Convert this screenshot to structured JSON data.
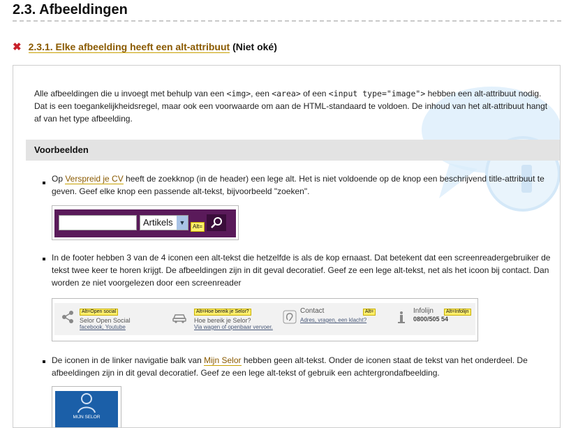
{
  "page": {
    "title": "2.3. Afbeeldingen"
  },
  "section": {
    "status": "fail",
    "link_text": "2.3.1. Elke afbeelding heeft een alt-attribuut",
    "status_text": "(Niet oké)"
  },
  "intro": {
    "t1": "Alle afbeeldingen die u invoegt met behulp van een ",
    "c1": "<img>",
    "t2": ", een ",
    "c2": "<area>",
    "t3": " of een ",
    "c3": "<input type=\"image\">",
    "t4": " hebben een alt-attribuut nodig. Dat is een toegankelijkheidsregel, maar ook een voorwaarde om aan de HTML-standaard te voldoen. De inhoud van het alt-attribuut hangt af van het type afbeelding."
  },
  "examples": {
    "heading": "Voorbeelden",
    "items": [
      {
        "pre": "Op ",
        "link": "Verspreid je CV",
        "post": " heeft de zoekknop (in de header) een lege alt. Het is niet voldoende op de knop een beschrijvend title-attribuut te geven. Geef elke knop een passende alt-tekst, bijvoorbeeld \"zoeken\"."
      },
      {
        "pre": "",
        "link": "",
        "post": "In de footer hebben 3 van de 4 iconen een alt-tekst die hetzelfde is als de kop ernaast. Dat betekent dat een screenreadergebruiker de tekst twee keer te horen krijgt. De afbeeldingen zijn in dit geval decoratief. Geef ze een lege alt-tekst, net als het icoon bij contact. Dan worden ze niet voorgelezen door een screenreader"
      },
      {
        "pre": "De iconen in de linker navigatie balk van ",
        "link": "Mijn Selor",
        "post": " hebben geen alt-tekst. Onder de iconen staat de tekst van het onderdeel. De afbeeldingen zijn in dit geval decoratief. Geef ze een lege alt-tekst of gebruik een achtergrondafbeelding."
      }
    ]
  },
  "search_example": {
    "select_value": "Artikels",
    "alt_label": "Alt="
  },
  "footer_example": {
    "tiles": [
      {
        "icon": "share-icon",
        "alt": "Alt=Open social",
        "line1": "Selor Open Social",
        "line2": "facebook, Youtube"
      },
      {
        "icon": "car-icon",
        "alt": "Alt=Hoe bereik je Selor?",
        "line1": "Hoe bereik je Selor?",
        "line2": "Via wagen of openbaar vervoer."
      },
      {
        "icon": "ear-icon",
        "alt": "Alt=",
        "line1": "Contact",
        "line2": "Adres, vragen, een klacht?"
      },
      {
        "icon": "info-icon",
        "alt": "Alt=Infolijn",
        "line1": "Infolijn",
        "line2": "0800/505 54"
      }
    ]
  },
  "selor_example": {
    "label": "MIJN SELOR"
  },
  "colors": {
    "fail": "#c8202a",
    "link": "#8a5a00",
    "examples_bar": "#e3e3e3",
    "alt_tag": "#ffef6b",
    "search_bg": "#5a1a5a",
    "selor_tile": "#1b5fa8"
  }
}
